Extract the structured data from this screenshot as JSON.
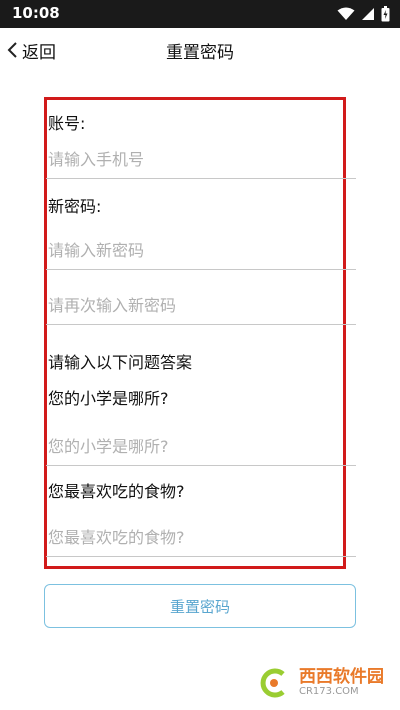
{
  "status_bar": {
    "time": "10:08",
    "icons": [
      "wifi-icon",
      "cellular-icon",
      "battery-icon"
    ]
  },
  "app_bar": {
    "back_label": "返回",
    "title": "重置密码"
  },
  "form": {
    "account_label": "账号:",
    "phone_placeholder": "请输入手机号",
    "new_password_label": "新密码:",
    "new_password_placeholder": "请输入新密码",
    "confirm_password_placeholder": "请再次输入新密码",
    "security_heading": "请输入以下问题答案",
    "question1_label": "您的小学是哪所?",
    "question1_placeholder": "您的小学是哪所?",
    "question2_label": "您最喜欢吃的食物?",
    "question2_placeholder": "您最喜欢吃的食物?"
  },
  "actions": {
    "reset_button": "重置密码"
  },
  "watermark": {
    "main": "西西软件园",
    "sub": "CR173.COM"
  },
  "colors": {
    "status_bar": "#1a1a1a",
    "highlight": "#d11a1a",
    "button_border": "#7cc1e0",
    "button_text": "#5aa6cf",
    "watermark": "#e97a2a"
  }
}
